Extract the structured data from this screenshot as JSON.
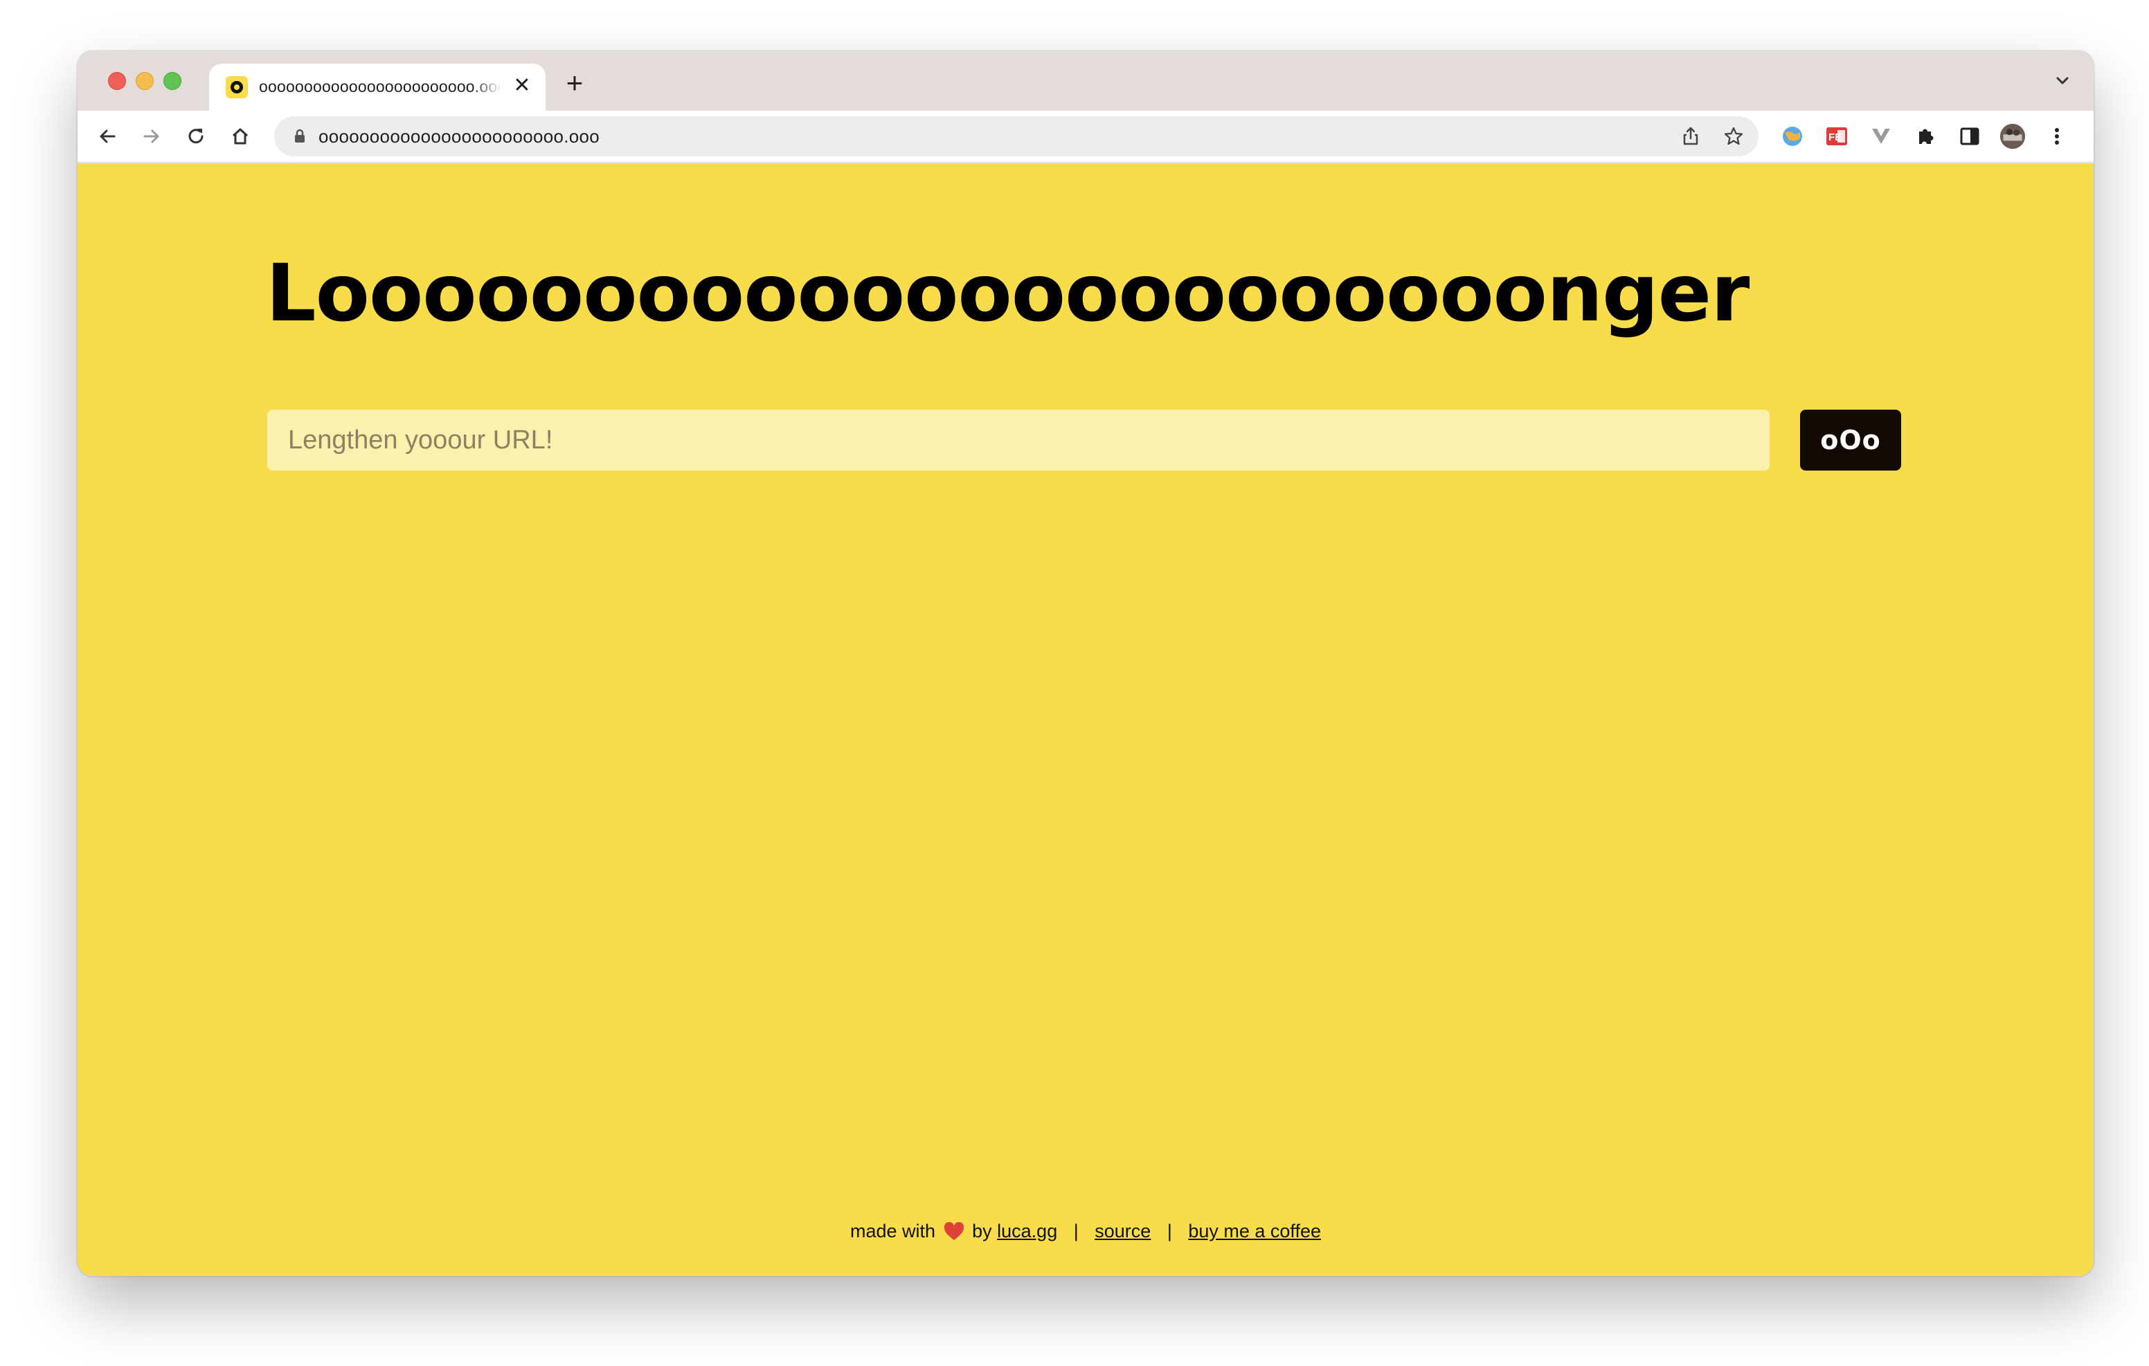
{
  "browser": {
    "tab": {
      "title": "oooooooooooooooooooooooo.ooo",
      "close_glyph": "✕"
    },
    "new_tab_glyph": "+",
    "address_bar": {
      "url": "oooooooooooooooooooooooo.ooo"
    },
    "icons": {
      "back": "back-arrow-icon",
      "forward": "forward-arrow-icon",
      "reload": "reload-icon",
      "home": "home-icon",
      "lock": "lock-icon",
      "share": "share-icon",
      "bookmark": "star-icon",
      "extensions": "puzzle-icon",
      "side_panel": "side-panel-icon",
      "menu": "kebab-menu-icon"
    }
  },
  "page": {
    "headline": "Looooooooooooooooooooooonger",
    "input": {
      "placeholder": "Lengthen yooour URL!",
      "value": ""
    },
    "submit_label": "oOo",
    "footer": {
      "made_with": "made with",
      "by": "by",
      "author_link": "luca.gg",
      "separator": "|",
      "source_link": "source",
      "coffee_link": "buy me a coffee"
    }
  },
  "colors": {
    "page_background": "#f9dc4a",
    "input_background": "#fbf0ad",
    "button_background": "#120a00",
    "heart": "#e0413a"
  }
}
